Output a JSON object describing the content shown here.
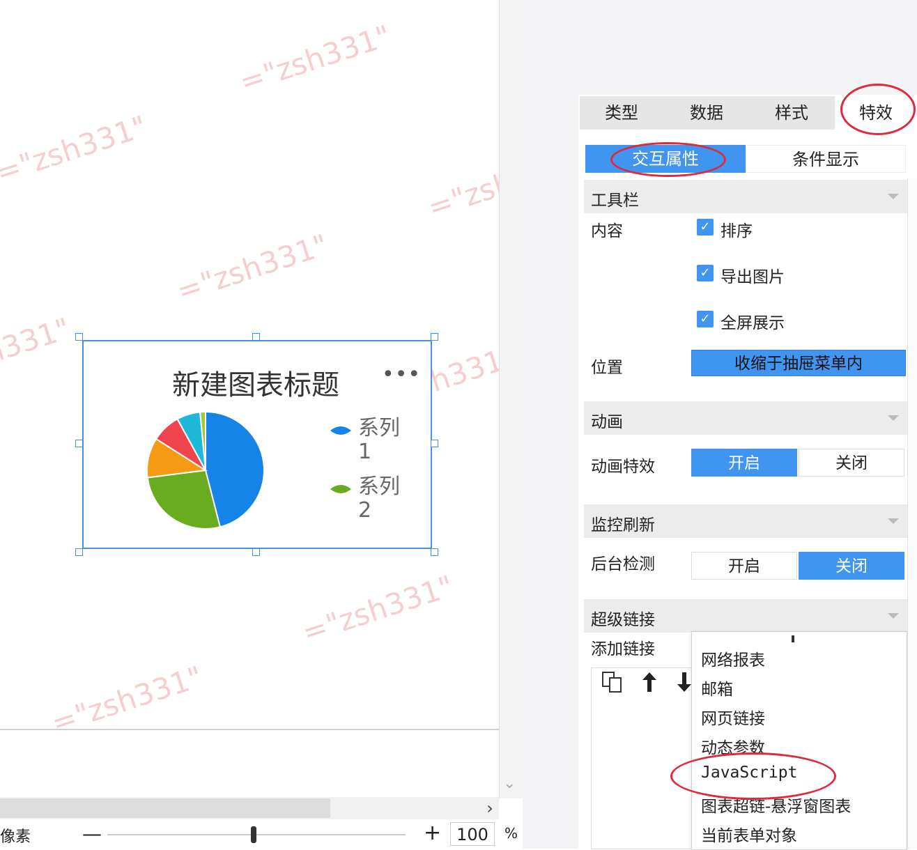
{
  "watermark": "=\"zsh331\"",
  "chart": {
    "title": "新建图表标题",
    "more": "•••"
  },
  "chart_data": {
    "type": "pie",
    "title": "新建图表标题",
    "legend": [
      "系列 1",
      "系列 2"
    ],
    "slices": [
      {
        "value": 46,
        "color": "#1684e6"
      },
      {
        "value": 27,
        "color": "#6aac1f"
      },
      {
        "value": 11,
        "color": "#f59a12"
      },
      {
        "value": 8,
        "color": "#f0444f"
      },
      {
        "value": 6.5,
        "color": "#20b8d8"
      },
      {
        "value": 1.5,
        "color": "#a4c639"
      }
    ]
  },
  "legend_labels": {
    "series1_line1": "系列",
    "series1_line2": "1",
    "series2_line1": "系列",
    "series2_line2": "2"
  },
  "legend_colors": {
    "series1": "#1684e6",
    "series2": "#6aac1f"
  },
  "statusbar": {
    "unit": "像素",
    "minus": "—",
    "plus": "+",
    "zoom_value": "100",
    "zoom_unit": "%"
  },
  "tabs": {
    "type": "类型",
    "data": "数据",
    "style": "样式",
    "effects": "特效"
  },
  "subtabs": {
    "interact": "交互属性",
    "condition": "条件显示"
  },
  "toolbar_section": {
    "title": "工具栏",
    "content_label": "内容",
    "options": [
      "排序",
      "导出图片",
      "全屏展示"
    ],
    "position_label": "位置",
    "position_value": "收缩于抽屉菜单内"
  },
  "animation_section": {
    "title": "动画",
    "label": "动画特效",
    "on": "开启",
    "off": "关闭",
    "selected": "开启"
  },
  "monitor_section": {
    "title": "监控刷新",
    "label": "后台检测",
    "on": "开启",
    "off": "关闭",
    "selected": "关闭"
  },
  "hyperlink_section": {
    "title": "超级链接",
    "add_label": "添加链接",
    "menu": [
      "网络报表",
      "邮箱",
      "网页链接",
      "动态参数",
      "JavaScript",
      "图表超链-悬浮窗图表",
      "当前表单对象"
    ]
  },
  "accent_color": "#3f95f0",
  "highlight_color": "#e0293a"
}
